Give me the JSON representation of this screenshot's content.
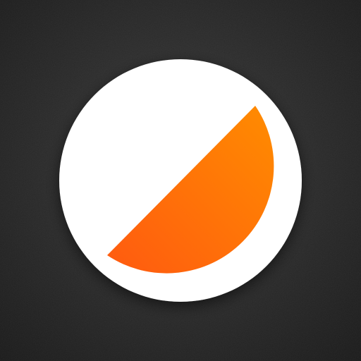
{
  "icon": {
    "semantic": "half-circle-icon",
    "colors": {
      "background_center": "#3a3a3a",
      "background_edge": "#1a1a1a",
      "ring": "#ffffff",
      "inner_white": "#ffffff",
      "accent_start": "#ff8c00",
      "accent_end": "#ff5a10"
    }
  }
}
